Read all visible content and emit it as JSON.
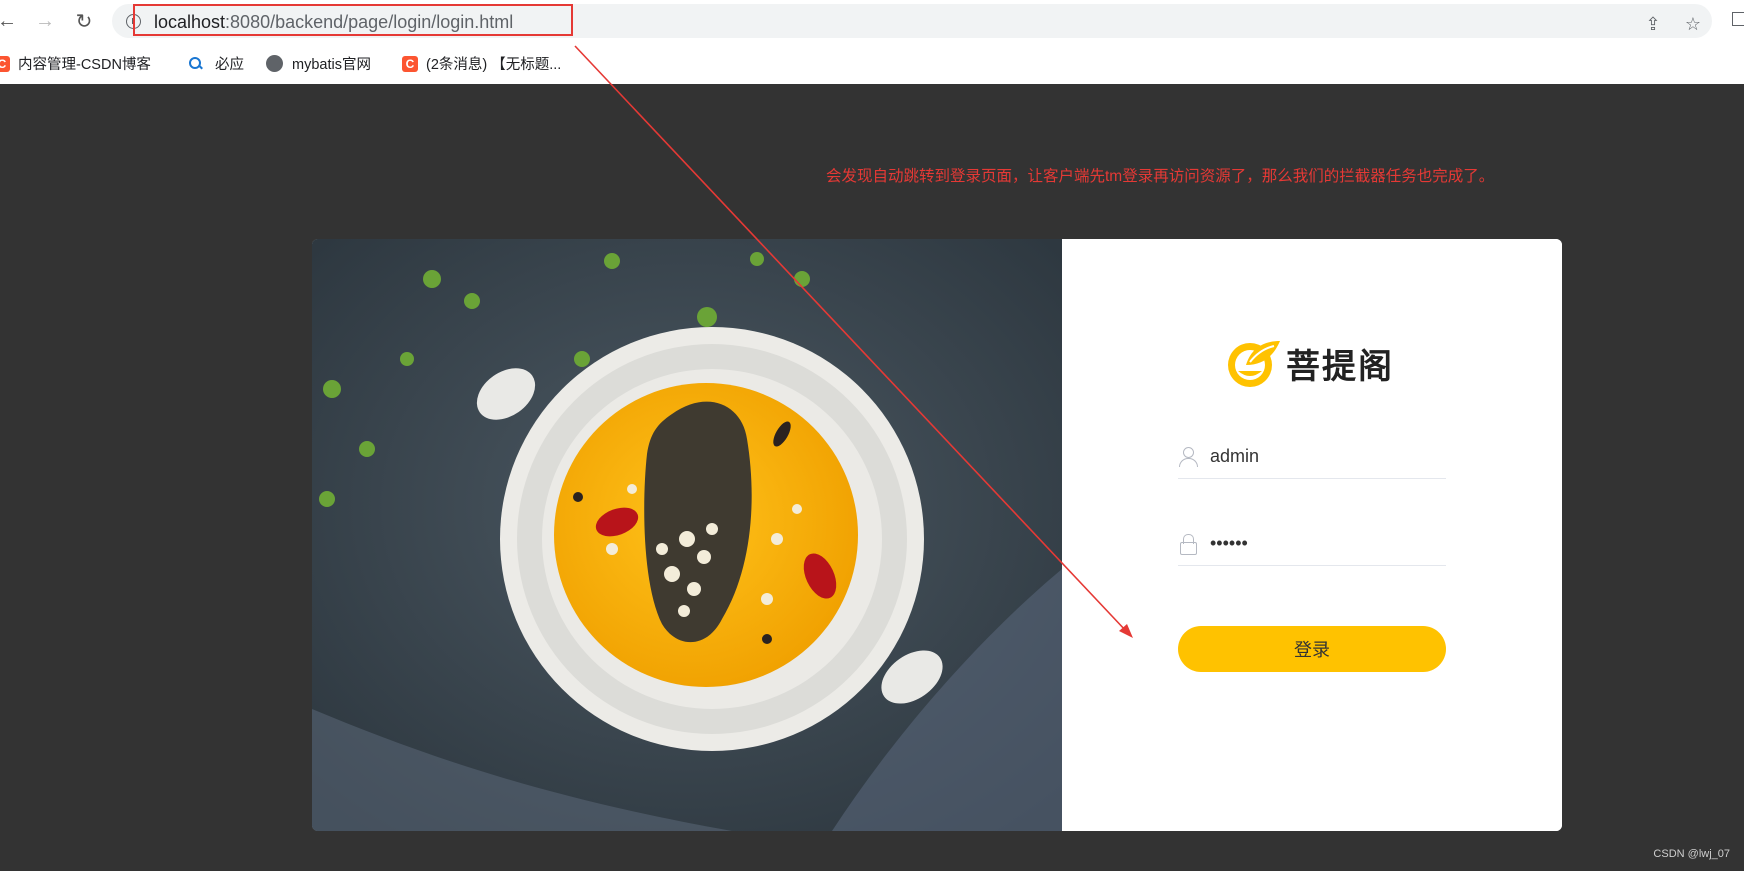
{
  "browser": {
    "url_host": "localhost",
    "url_rest": ":8080/backend/page/login/login.html",
    "bookmarks": [
      {
        "label": "内容管理-CSDN博客",
        "icon": "csdn-icon"
      },
      {
        "label": "必应",
        "icon": "search-icon"
      },
      {
        "label": "mybatis官网",
        "icon": "globe-icon"
      },
      {
        "label": "(2条消息) 【无标题...",
        "icon": "csdn-icon"
      }
    ]
  },
  "annotation": {
    "text": "会发现自动跳转到登录页面，让客户端先tm登录再访问资源了，那么我们的拦截器任务也完成了。",
    "color": "#e53935"
  },
  "login": {
    "brand_name": "菩提阁",
    "username_value": "admin",
    "password_value": "••••••",
    "button_label": "登录",
    "accent": "#ffc200"
  },
  "watermark": "CSDN @lwj_07"
}
